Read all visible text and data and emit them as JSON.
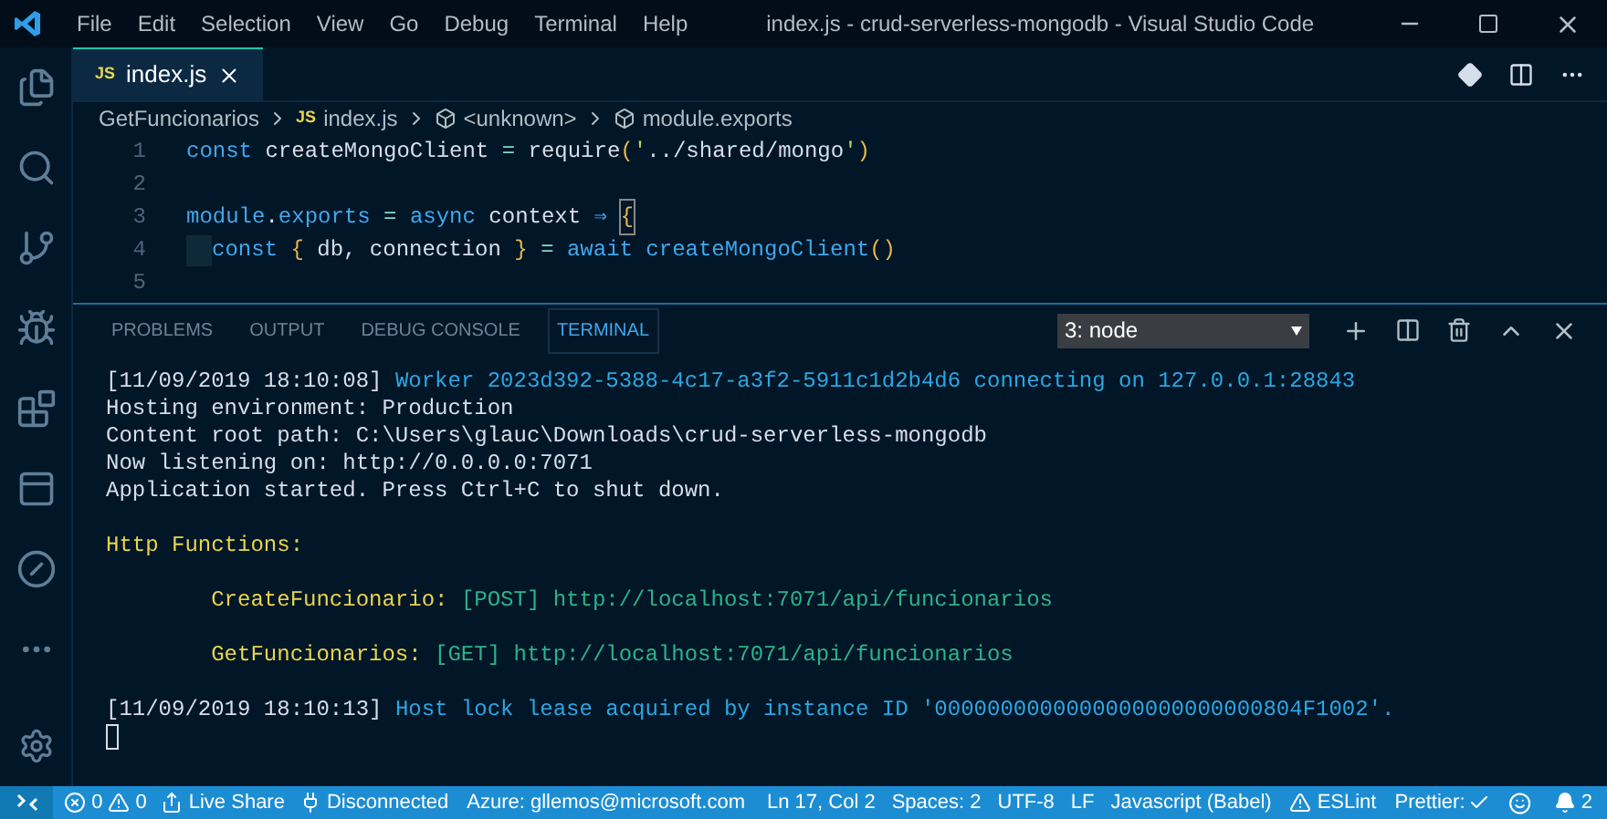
{
  "menu": [
    "File",
    "Edit",
    "Selection",
    "View",
    "Go",
    "Debug",
    "Terminal",
    "Help"
  ],
  "window": {
    "title": "index.js - crud-serverless-mongodb - Visual Studio Code"
  },
  "tabs": [
    {
      "label": "index.js",
      "badge": "JS",
      "selected": true
    }
  ],
  "breadcrumb": {
    "folder": "GetFuncionarios",
    "file": "index.js",
    "file_badge": "JS",
    "symbols": [
      "<unknown>",
      "module.exports"
    ]
  },
  "code": [
    {
      "number": "1",
      "tokens": [
        {
          "kind": "kw",
          "text": "const"
        },
        {
          "kind": "id",
          "text": " createMongoClient "
        },
        {
          "kind": "op",
          "text": "="
        },
        {
          "kind": "id",
          "text": " require"
        },
        {
          "kind": "paren",
          "text": "("
        },
        {
          "kind": "quote",
          "text": "'"
        },
        {
          "kind": "id",
          "text": "../shared/mongo"
        },
        {
          "kind": "quote",
          "text": "'"
        },
        {
          "kind": "paren",
          "text": ")"
        }
      ]
    },
    {
      "number": "2"
    },
    {
      "number": "3",
      "tokens": [
        {
          "kind": "kw",
          "text": "module"
        },
        {
          "kind": "id",
          "text": "."
        },
        {
          "kind": "kw",
          "text": "exports"
        },
        {
          "kind": "op",
          "text": " = "
        },
        {
          "kind": "kw",
          "text": "async"
        },
        {
          "kind": "id",
          "text": " context "
        },
        {
          "kind": "kw",
          "text": "⇒ "
        },
        {
          "kind": "bracket",
          "text": "{"
        }
      ]
    },
    {
      "number": "4",
      "tokens": [
        {
          "kind": "indent"
        },
        {
          "kind": "kw",
          "text": "const"
        },
        {
          "kind": "paren",
          "text": " { "
        },
        {
          "kind": "id",
          "text": "db, connection"
        },
        {
          "kind": "paren",
          "text": " } "
        },
        {
          "kind": "op",
          "text": "= "
        },
        {
          "kind": "kw",
          "text": "await createMongoClient"
        },
        {
          "kind": "paren",
          "text": "()"
        }
      ]
    },
    {
      "number": "5"
    }
  ],
  "panel": {
    "tabs": [
      {
        "label": "PROBLEMS",
        "selected": false
      },
      {
        "label": "OUTPUT",
        "selected": false
      },
      {
        "label": "DEBUG CONSOLE",
        "selected": false
      },
      {
        "label": "TERMINAL",
        "selected": true
      }
    ],
    "terminal_select": "3: node"
  },
  "terminal": [
    [
      {
        "kind": "plain",
        "text": "[11/09/2019 18:10:08] "
      },
      {
        "kind": "info",
        "text": "Worker 2023d392-5388-4c17-a3f2-5911c1d2b4d6 connecting on 127.0.0.1:28843"
      }
    ],
    [
      {
        "kind": "plain",
        "text": "Hosting environment: Production"
      }
    ],
    [
      {
        "kind": "plain",
        "text": "Content root path: C:\\Users\\glauc\\Downloads\\crud-serverless-mongodb"
      }
    ],
    [
      {
        "kind": "plain",
        "text": "Now listening on: http://0.0.0.0:7071"
      }
    ],
    [
      {
        "kind": "plain",
        "text": "Application started. Press Ctrl+C to shut down."
      }
    ],
    [
      {
        "kind": "blank"
      }
    ],
    [
      {
        "kind": "yellow",
        "text": "Http Functions:"
      }
    ],
    [
      {
        "kind": "blank"
      }
    ],
    [
      {
        "kind": "yellow",
        "text": "        CreateFuncionario: "
      },
      {
        "kind": "green",
        "text": "[POST] http://localhost:7071/api/funcionarios"
      }
    ],
    [
      {
        "kind": "blank"
      }
    ],
    [
      {
        "kind": "yellow",
        "text": "        GetFuncionarios: "
      },
      {
        "kind": "green",
        "text": "[GET] http://localhost:7071/api/funcionarios"
      }
    ],
    [
      {
        "kind": "blank"
      }
    ],
    [
      {
        "kind": "plain",
        "text": "[11/09/2019 18:10:13] "
      },
      {
        "kind": "info",
        "text": "Host lock lease acquired by instance ID '0000000000000000000000000804F1002'."
      }
    ]
  ],
  "status_bar": {
    "errors": "0",
    "warnings": "0",
    "live_share": "Live Share",
    "connection": "Disconnected",
    "azure": "Azure: gllemos@microsoft.com",
    "position": "Ln 17, Col 2",
    "spaces": "Spaces: 2",
    "encoding": "UTF-8",
    "eol": "LF",
    "language": "Javascript (Babel)",
    "eslint": "ESLint",
    "prettier": "Prettier:",
    "notifications": "2"
  }
}
